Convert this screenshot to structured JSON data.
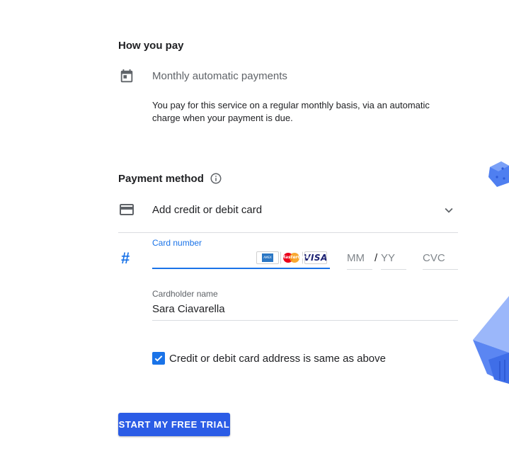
{
  "how_you_pay": {
    "title": "How you pay",
    "option_label": "Monthly automatic payments",
    "description": "You pay for this service on a regular monthly basis, via an automatic charge when your payment is due."
  },
  "payment_method": {
    "title": "Payment method",
    "selector_label": "Add credit or debit card"
  },
  "card_form": {
    "card_number_label": "Card number",
    "card_number_value": "",
    "card_brands": [
      "American Express",
      "MasterCard",
      "VISA"
    ],
    "mastercard_text": "MasterCard",
    "visa_text": "VISA",
    "amex_text": "AMEX",
    "expiry_month_placeholder": "MM",
    "expiry_separator": "/",
    "expiry_year_placeholder": "YY",
    "cvc_placeholder": "CVC",
    "cardholder_label": "Cardholder name",
    "cardholder_value": "Sara Ciavarella"
  },
  "address_checkbox": {
    "checked": true,
    "label": "Credit or debit card address is same as above"
  },
  "submit_button": {
    "label": "START MY FREE TRIAL"
  },
  "colors": {
    "accent": "#1a73e8",
    "button": "#2b5ce6",
    "decoration": "#4f7ff0"
  }
}
